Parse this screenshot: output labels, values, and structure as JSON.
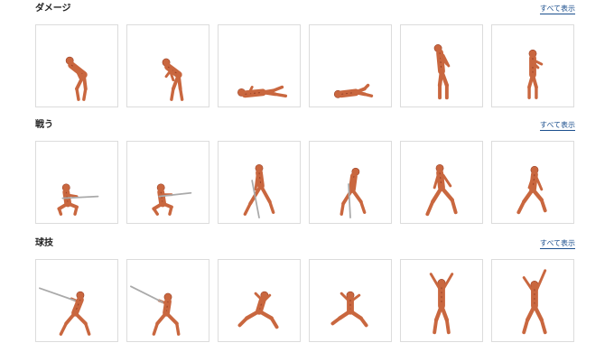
{
  "sections": [
    {
      "title": "ダメージ",
      "see_all": "すべて表示",
      "items": [
        {
          "pose": "doubled-over-clutching-stomach"
        },
        {
          "pose": "bent-forward-hurt"
        },
        {
          "pose": "lying-collapsed"
        },
        {
          "pose": "lying-collapsed-small"
        },
        {
          "pose": "standing-clutching-side"
        },
        {
          "pose": "standing-clutching-chest"
        }
      ]
    },
    {
      "title": "戦う",
      "see_all": "すべて表示",
      "items": [
        {
          "pose": "kneeling-with-spear"
        },
        {
          "pose": "crouching-with-spear"
        },
        {
          "pose": "standing-leaning-on-staff"
        },
        {
          "pose": "standing-leaning-on-staff-2"
        },
        {
          "pose": "wide-stance-fists"
        },
        {
          "pose": "wide-stance-fists-2"
        }
      ]
    },
    {
      "title": "球技",
      "see_all": "すべて表示",
      "items": [
        {
          "pose": "swinging-bat"
        },
        {
          "pose": "swinging-bat-2"
        },
        {
          "pose": "lunging-catch"
        },
        {
          "pose": "lunging-catch-2"
        },
        {
          "pose": "arms-raised-jump"
        },
        {
          "pose": "arms-raised-jump-2"
        }
      ]
    }
  ],
  "colors": {
    "accent_link": "#1b4f8e",
    "figure": "#c9673f",
    "figure_dark": "#9a4026",
    "thumb_border": "#dcdcdc"
  }
}
